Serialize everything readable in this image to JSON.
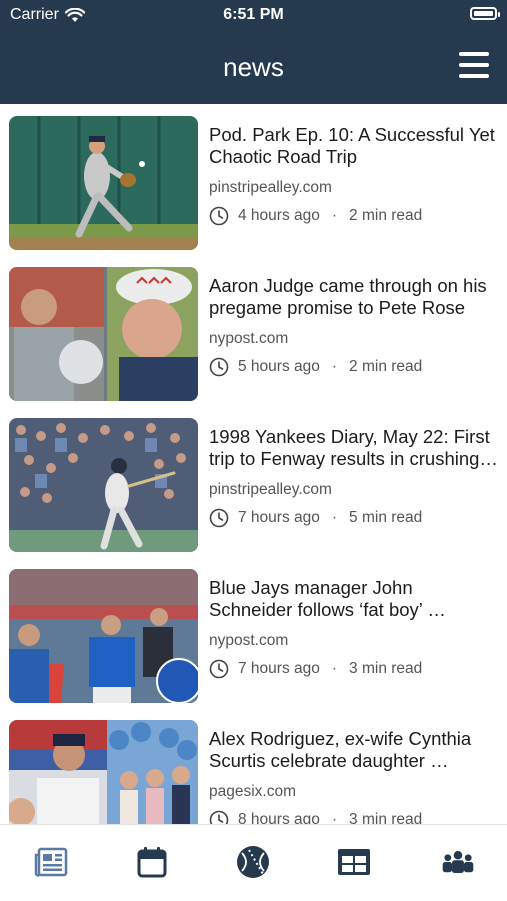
{
  "status": {
    "carrier": "Carrier",
    "time": "6:51 PM"
  },
  "header": {
    "title": "news",
    "menu_icon": "hamburger-menu-icon"
  },
  "articles": [
    {
      "title": "Pod. Park Ep. 10: A Successful Yet Chaotic Road Trip",
      "source": "pinstripealley.com",
      "age": "4 hours ago",
      "read": "2 min read"
    },
    {
      "title": "Aaron Judge came through on his pregame promise to Pete Rose",
      "source": "nypost.com",
      "age": "5 hours ago",
      "read": "2 min read"
    },
    {
      "title": "1998 Yankees Diary, May 22: First trip to Fenway results in crushing…",
      "source": "pinstripealley.com",
      "age": "7 hours ago",
      "read": "5 min read"
    },
    {
      "title": "Blue Jays manager John Schneider follows ‘fat boy’ …",
      "source": "nypost.com",
      "age": "7 hours ago",
      "read": "3 min read"
    },
    {
      "title": "Alex Rodriguez, ex-wife Cynthia Scurtis celebrate daughter …",
      "source": "pagesix.com",
      "age": "8 hours ago",
      "read": "3 min read"
    }
  ],
  "tabs": [
    {
      "icon": "newspaper-icon",
      "active": true
    },
    {
      "icon": "calendar-icon",
      "active": false
    },
    {
      "icon": "baseball-icon",
      "active": false
    },
    {
      "icon": "standings-table-icon",
      "active": false
    },
    {
      "icon": "team-players-icon",
      "active": false
    }
  ],
  "colors": {
    "header": "#25394f",
    "tab_active": "#5b7aa3",
    "tab_inactive": "#25394f"
  }
}
